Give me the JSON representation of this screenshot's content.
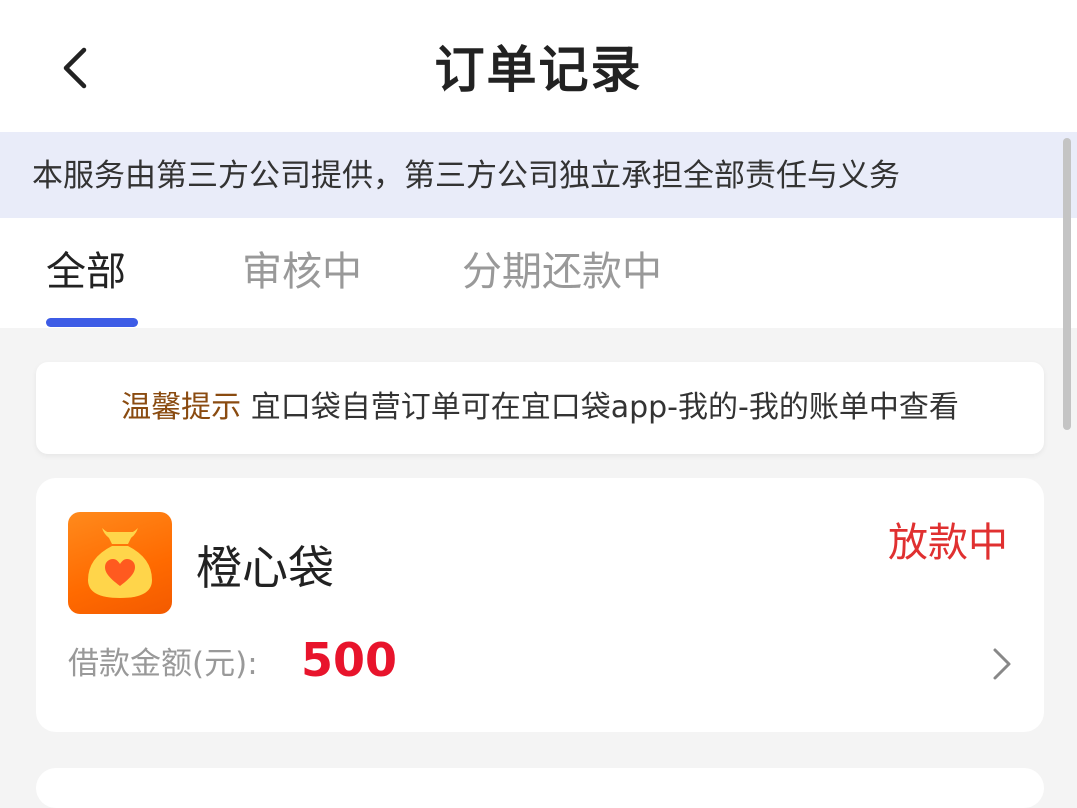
{
  "header": {
    "title": "订单记录",
    "back_icon": "chevron-left-icon"
  },
  "notice": {
    "text": "本服务由第三方公司提供，第三方公司独立承担全部责任与义务"
  },
  "tabs": [
    {
      "label": "全部",
      "active": true
    },
    {
      "label": "审核中",
      "active": false
    },
    {
      "label": "分期还款中",
      "active": false
    }
  ],
  "tip": {
    "label": "温馨提示",
    "message": "宜口袋自营订单可在宜口袋app-我的-我的账单中查看"
  },
  "orders": [
    {
      "app_name": "橙心袋",
      "logo_icon": "money-bag-heart-icon",
      "status": "放款中",
      "amount_label": "借款金额(元):",
      "amount": "500",
      "chevron_icon": "chevron-right-icon"
    }
  ],
  "colors": {
    "accent": "#3d5ce6",
    "status_red": "#e03030",
    "amount_red": "#e8142c",
    "tip_brown": "#8a4b10",
    "notice_bg": "#e9ecf9",
    "logo_orange": "#ff6a00"
  }
}
